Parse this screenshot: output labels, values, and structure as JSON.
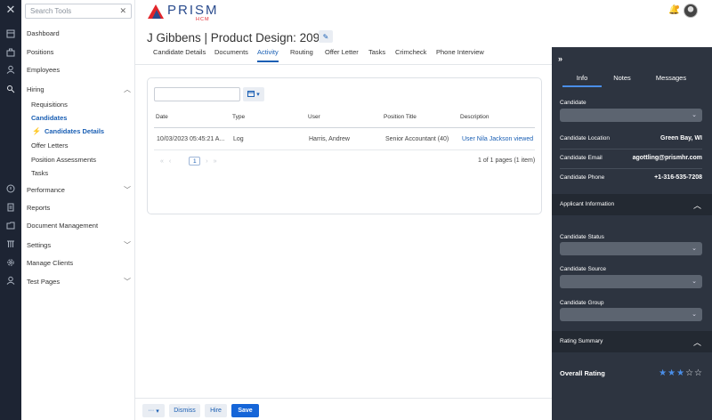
{
  "rail": {
    "icons": [
      "close-icon",
      "dashboard-icon",
      "positions-icon",
      "employees-icon",
      "hiring-icon",
      "performance-icon",
      "reports-icon",
      "documents-icon",
      "settings-icon",
      "clients-icon",
      "test-pages-icon"
    ]
  },
  "sidebar": {
    "search_placeholder": "Search Tools",
    "items": {
      "dashboard": "Dashboard",
      "positions": "Positions",
      "employees": "Employees",
      "hiring": "Hiring",
      "requisitions": "Requisitions",
      "candidates": "Candidates",
      "candidates_details": "Candidates Details",
      "offer_letters": "Offer Letters",
      "position_assessments": "Position Assessments",
      "tasks": "Tasks",
      "performance": "Performance",
      "reports": "Reports",
      "document_management": "Document Management",
      "settings": "Settings",
      "manage_clients": "Manage Clients",
      "test_pages": "Test Pages"
    }
  },
  "brand": {
    "name": "PRISM",
    "sub": "HCM"
  },
  "header": {
    "title": "J Gibbens | Product Design: 20997"
  },
  "tabs": {
    "candidate_details": "Candidate Details",
    "documents": "Documents",
    "activity": "Activity",
    "routing": "Routing",
    "offer_letter": "Offer Letter",
    "tasks": "Tasks",
    "crimcheck": "Crimcheck",
    "phone_interview": "Phone Interview"
  },
  "activity": {
    "columns": {
      "date": "Date",
      "type": "Type",
      "user": "User",
      "position_title": "Position Title",
      "description": "Description"
    },
    "rows": [
      {
        "date": "10/03/2023 05:45:21 A...",
        "type": "Log",
        "user": "Harris, Andrew",
        "position_title": "Senior Accountant (40)",
        "description": "User Nila Jackson viewed"
      }
    ],
    "pager": {
      "current_page": "1",
      "info": "1 of 1 pages (1 item)"
    }
  },
  "actions": {
    "more": "···",
    "dismiss": "Dismiss",
    "hire": "Hire",
    "save": "Save"
  },
  "right_panel": {
    "tabs": {
      "info": "Info",
      "notes": "Notes",
      "messages": "Messages"
    },
    "candidate_label": "Candidate",
    "location_label": "Candidate Location",
    "location_value": "Green Bay, WI",
    "email_label": "Candidate Email",
    "email_value": "agottling@prismhr.com",
    "phone_label": "Candidate Phone",
    "phone_value": "+1-316-535-7208",
    "applicant_info": "Applicant Information",
    "status_label": "Candidate Status",
    "source_label": "Candidate Source",
    "group_label": "Candidate Group",
    "rating_summary": "Rating Summary",
    "overall_rating_label": "Overall Rating",
    "overall_rating": 3,
    "rating_max": 5
  },
  "colors": {
    "accent": "#1a5fb4",
    "brand_red": "#e2252b",
    "brand_blue": "#2a4b8d",
    "panel": "#2d3440",
    "star": "#4a8ee8"
  }
}
